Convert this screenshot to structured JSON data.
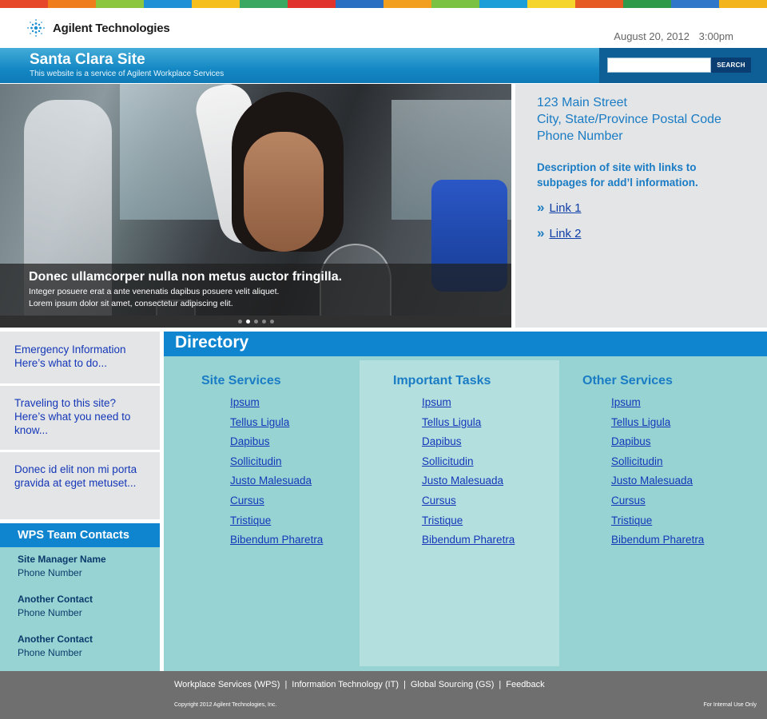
{
  "header": {
    "logo_text": "Agilent Technologies",
    "date": "August 20, 2012",
    "time": "3:00pm"
  },
  "banner": {
    "title": "Santa Clara Site",
    "subtitle": "This website is a service of Agilent Workplace Services",
    "search_value": "",
    "search_button": "SEARCH"
  },
  "colors": {
    "strip": [
      "#e6462a",
      "#f07d1c",
      "#8cc63e",
      "#1f8fd6",
      "#f5c01e",
      "#3aa860",
      "#e0332c",
      "#2b6fc2",
      "#f29f1f",
      "#7cc242",
      "#1c9ed9",
      "#f5d52b",
      "#e65b23",
      "#2f9a4a",
      "#3076c9",
      "#f3b31a"
    ],
    "accent": "#0f84cf",
    "panel_teal": "#97d3d3"
  },
  "hero": {
    "title": "Donec ullamcorper nulla non metus auctor fringilla.",
    "line1": "Integer posuere erat a ante venenatis dapibus posuere velit aliquet.",
    "line2": "Lorem ipsum dolor sit amet, consectetur adipiscing elit.",
    "slides": 5,
    "active_slide": 2
  },
  "address": {
    "street": "123 Main Street",
    "city": "City, State/Province Postal Code",
    "phone": "Phone Number",
    "description": "Description of site with links to subpages for add’l information.",
    "links": [
      "Link 1",
      "Link 2"
    ]
  },
  "sidebar": {
    "boxes": [
      "Emergency Information Here’s what to do...",
      "Traveling to this site? Here’s what you need to know...",
      "Donec id elit non mi porta gravida at eget metuset..."
    ],
    "contacts_title": "WPS Team Contacts",
    "contacts": [
      {
        "name": "Site Manager Name",
        "phone": "Phone Number"
      },
      {
        "name": "Another Contact",
        "phone": "Phone Number"
      },
      {
        "name": "Another Contact",
        "phone": "Phone Number"
      }
    ]
  },
  "directory": {
    "title": "Directory",
    "columns": [
      {
        "title": "Site Services",
        "links": [
          "Ipsum",
          "Tellus Ligula",
          "Dapibus",
          "Sollicitudin",
          "Justo Malesuada",
          "Cursus",
          "Tristique",
          "Bibendum Pharetra"
        ]
      },
      {
        "title": "Important Tasks",
        "links": [
          "Ipsum",
          "Tellus Ligula",
          "Dapibus",
          "Sollicitudin",
          "Justo Malesuada",
          "Cursus",
          "Tristique",
          "Bibendum Pharetra"
        ]
      },
      {
        "title": "Other Services",
        "links": [
          "Ipsum",
          "Tellus Ligula",
          "Dapibus",
          "Sollicitudin",
          "Justo Malesuada",
          "Cursus",
          "Tristique",
          "Bibendum Pharetra"
        ]
      }
    ]
  },
  "footer": {
    "links": [
      "Workplace Services (WPS)",
      "Information Technology (IT)",
      "Global Sourcing (GS)",
      "Feedback"
    ],
    "copyright": "Copyright 2012  Agilent Technologies, Inc.",
    "internal": "For Internal Use Only"
  }
}
